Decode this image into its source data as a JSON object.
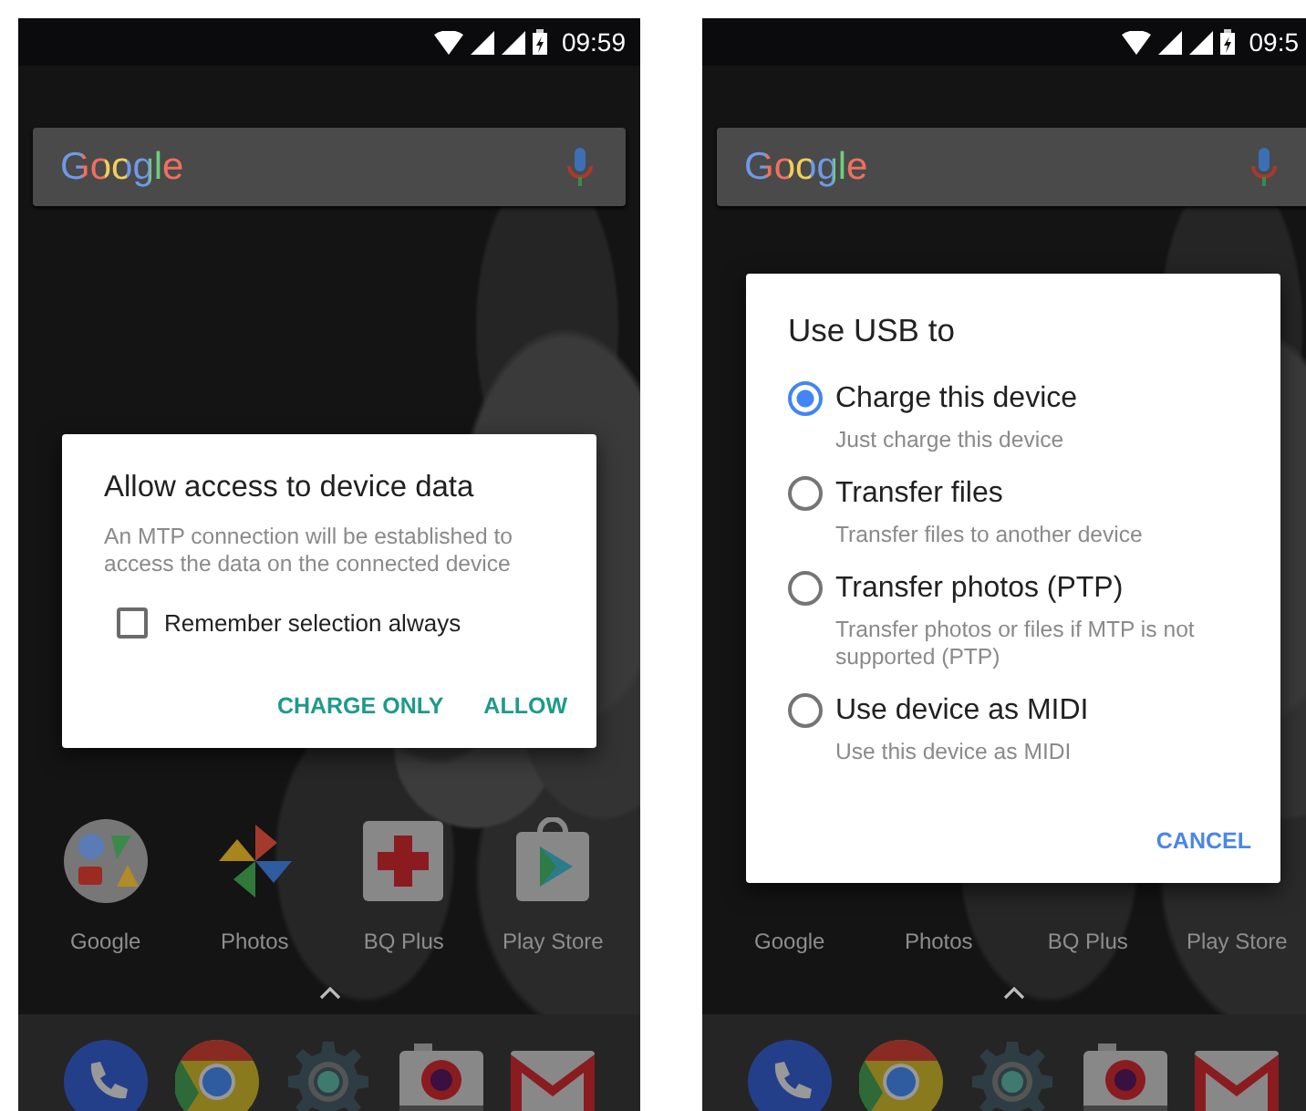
{
  "screens": [
    {
      "status_bar": {
        "time": "09:59"
      },
      "search_bar": {
        "logo": "Google"
      },
      "home_apps": [
        {
          "label": "Google",
          "kind": "folder"
        },
        {
          "label": "Photos",
          "kind": "pinwheel"
        },
        {
          "label": "BQ Plus",
          "kind": "cross"
        },
        {
          "label": "Play Store",
          "kind": "bag"
        }
      ],
      "dock_apps": [
        {
          "kind": "phone"
        },
        {
          "kind": "browser"
        },
        {
          "kind": "settings"
        },
        {
          "kind": "camera"
        },
        {
          "kind": "mail"
        }
      ],
      "dialog": {
        "kind": "confirm",
        "title": "Allow access to device data",
        "message": "An MTP connection will be established to access the data on the connected device",
        "checkbox": {
          "label": "Remember selection always",
          "checked": false
        },
        "actions": [
          {
            "label": "CHARGE ONLY"
          },
          {
            "label": "ALLOW"
          }
        ]
      }
    },
    {
      "status_bar": {
        "time": "09:5"
      },
      "search_bar": {
        "logo": "Google"
      },
      "home_apps": [
        {
          "label": "Google"
        },
        {
          "label": "Photos"
        },
        {
          "label": "BQ Plus"
        },
        {
          "label": "Play Store"
        }
      ],
      "dock_apps": [
        {
          "kind": "phone"
        },
        {
          "kind": "browser"
        },
        {
          "kind": "settings"
        },
        {
          "kind": "camera"
        },
        {
          "kind": "mail"
        }
      ],
      "dialog": {
        "kind": "choice",
        "title": "Use USB to",
        "options": [
          {
            "label": "Charge this device",
            "description": "Just charge this device",
            "selected": true
          },
          {
            "label": "Transfer files",
            "description": "Transfer files to another device",
            "selected": false
          },
          {
            "label": "Transfer photos (PTP)",
            "description": "Transfer photos or files if MTP is not supported (PTP)",
            "selected": false
          },
          {
            "label": "Use device as MIDI",
            "description": "Use this device as MIDI",
            "selected": false
          }
        ],
        "actions": [
          {
            "label": "CANCEL"
          }
        ]
      }
    }
  ]
}
